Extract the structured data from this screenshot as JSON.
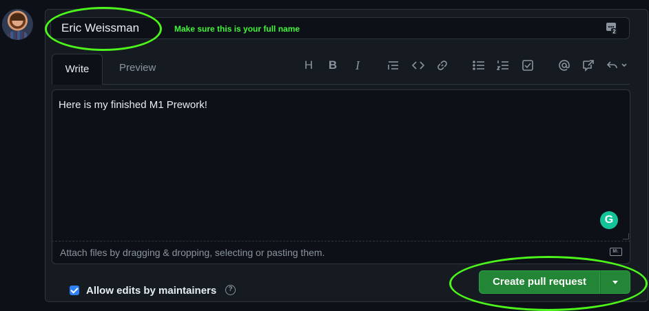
{
  "title_field": {
    "value": "Eric Weissman",
    "annotation": "Make sure this is your full name"
  },
  "tabs": [
    {
      "label": "Write",
      "active": true
    },
    {
      "label": "Preview",
      "active": false
    }
  ],
  "toolbar": {
    "heading": "H",
    "bold": "B",
    "italic": "I",
    "icons": [
      "heading-icon",
      "bold-icon",
      "italic-icon",
      "quote-icon",
      "code-icon",
      "link-icon",
      "bulleted-list-icon",
      "numbered-list-icon",
      "task-list-icon",
      "mention-icon",
      "reference-icon",
      "reply-icon"
    ]
  },
  "editor": {
    "body": "Here is my finished M1 Prework!"
  },
  "attach": {
    "text": "Attach files by dragging & dropping, selecting or pasting them."
  },
  "footer": {
    "allow_edits_label": "Allow edits by maintainers",
    "allow_edits_checked": true,
    "help_glyph": "?"
  },
  "actions": {
    "create_label": "Create pull request"
  },
  "colors": {
    "accent_green": "#238636",
    "highlight": "#4cf51a",
    "checkbox_blue": "#2f81f7"
  }
}
